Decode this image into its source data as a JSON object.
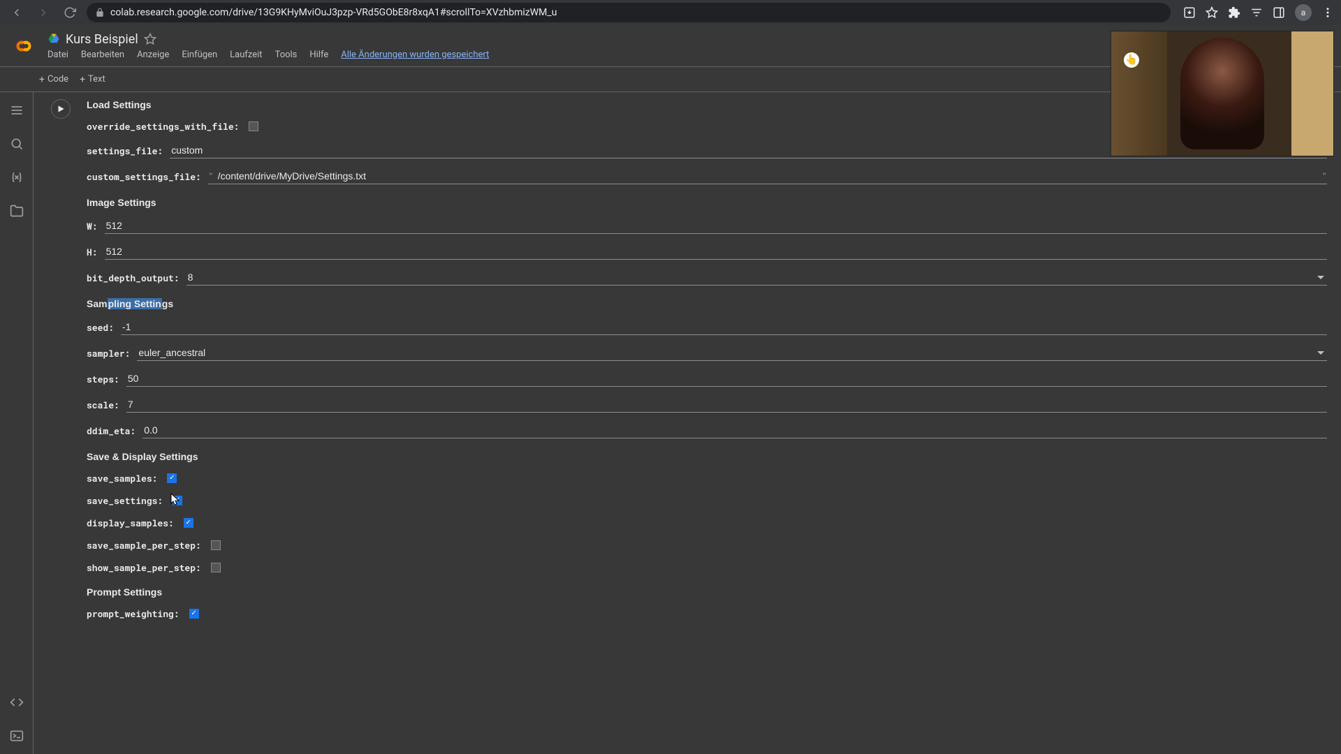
{
  "browser": {
    "url": "colab.research.google.com/drive/13G9KHyMviOuJ3pzp-VRd5GObE8r8xqA1#scrollTo=XVzhbmizWM_u",
    "avatar_initial": "a"
  },
  "header": {
    "title": "Kurs Beispiel",
    "menu": {
      "datei": "Datei",
      "bearbeiten": "Bearbeiten",
      "anzeige": "Anzeige",
      "einfuegen": "Einfügen",
      "laufzeit": "Laufzeit",
      "tools": "Tools",
      "hilfe": "Hilfe",
      "status": "Alle Änderungen wurden gespeichert"
    }
  },
  "toolbar": {
    "code": "Code",
    "text": "Text"
  },
  "sections": {
    "load": "Load Settings",
    "image": "Image Settings",
    "sampling_pre": "Sam",
    "sampling_sel": "pling Settin",
    "sampling_post": "gs",
    "save": "Save & Display Settings",
    "prompt": "Prompt Settings"
  },
  "fields": {
    "override_label": "override_settings_with_file:",
    "settings_file_label": "settings_file:",
    "settings_file_value": "custom",
    "custom_settings_file_label": "custom_settings_file:",
    "custom_settings_file_value": "/content/drive/MyDrive/Settings.txt",
    "w_label": "W:",
    "w_value": "512",
    "h_label": "H:",
    "h_value": "512",
    "bit_depth_label": "bit_depth_output:",
    "bit_depth_value": "8",
    "seed_label": "seed:",
    "seed_value": "-1",
    "sampler_label": "sampler:",
    "sampler_value": "euler_ancestral",
    "steps_label": "steps:",
    "steps_value": "50",
    "scale_label": "scale:",
    "scale_value": "7",
    "ddim_eta_label": "ddim_eta:",
    "ddim_eta_value": "0.0",
    "save_samples_label": "save_samples:",
    "save_settings_label": "save_settings:",
    "display_samples_label": "display_samples:",
    "save_sample_per_step_label": "save_sample_per_step:",
    "show_sample_per_step_label": "show_sample_per_step:",
    "prompt_weighting_label": "prompt_weighting:"
  }
}
